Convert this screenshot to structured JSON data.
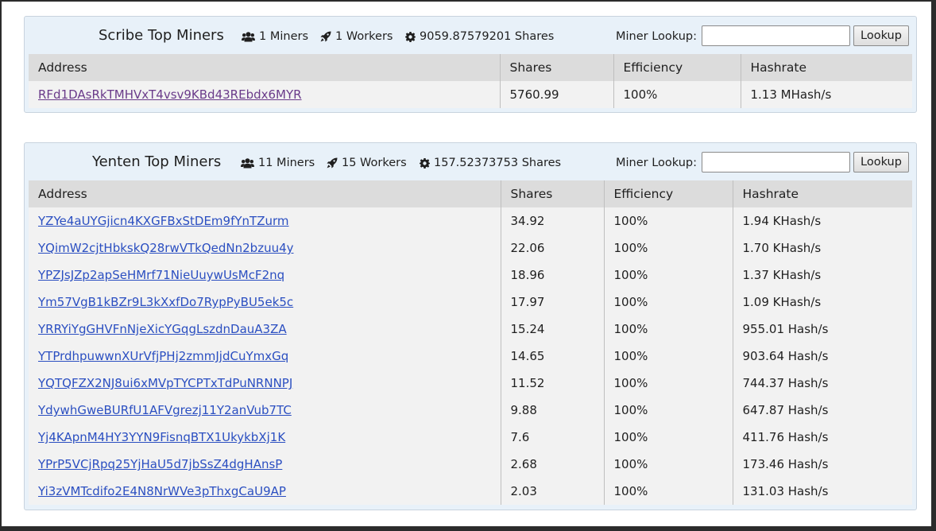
{
  "scribe": {
    "title": "Scribe Top Miners",
    "miners": "1 Miners",
    "workers": "1 Workers",
    "shares": "9059.87579201 Shares",
    "lookup_label": "Miner Lookup:",
    "lookup_value": "",
    "lookup_button": "Lookup",
    "columns": [
      "Address",
      "Shares",
      "Efficiency",
      "Hashrate"
    ],
    "rows": [
      {
        "address": "RFd1DAsRkTMHVxT4vsv9KBd43REbdx6MYR",
        "shares": "5760.99",
        "efficiency": "100%",
        "hashrate": "1.13 MHash/s"
      }
    ]
  },
  "yenten": {
    "title": "Yenten Top Miners",
    "miners": "11 Miners",
    "workers": "15 Workers",
    "shares": "157.52373753 Shares",
    "lookup_label": "Miner Lookup:",
    "lookup_value": "",
    "lookup_button": "Lookup",
    "columns": [
      "Address",
      "Shares",
      "Efficiency",
      "Hashrate"
    ],
    "rows": [
      {
        "address": "YZYe4aUYGjicn4KXGFBxStDEm9fYnTZurm",
        "shares": "34.92",
        "efficiency": "100%",
        "hashrate": "1.94 KHash/s"
      },
      {
        "address": "YQimW2cjtHbkskQ28rwVTkQedNn2bzuu4y",
        "shares": "22.06",
        "efficiency": "100%",
        "hashrate": "1.70 KHash/s"
      },
      {
        "address": "YPZJsJZp2apSeHMrf71NieUuywUsMcF2nq",
        "shares": "18.96",
        "efficiency": "100%",
        "hashrate": "1.37 KHash/s"
      },
      {
        "address": "Ym57VgB1kBZr9L3kXxfDo7RypPyBU5ek5c",
        "shares": "17.97",
        "efficiency": "100%",
        "hashrate": "1.09 KHash/s"
      },
      {
        "address": "YRRYiYgGHVFnNjeXicYGqgLszdnDauA3ZA",
        "shares": "15.24",
        "efficiency": "100%",
        "hashrate": "955.01 Hash/s"
      },
      {
        "address": "YTPrdhpuwwnXUrVfjPHj2zmmJjdCuYmxGq",
        "shares": "14.65",
        "efficiency": "100%",
        "hashrate": "903.64 Hash/s"
      },
      {
        "address": "YQTQFZX2NJ8ui6xMVpTYCPTxTdPuNRNNPJ",
        "shares": "11.52",
        "efficiency": "100%",
        "hashrate": "744.37 Hash/s"
      },
      {
        "address": "YdywhGweBURfU1AFVgrezj11Y2anVub7TC",
        "shares": "9.88",
        "efficiency": "100%",
        "hashrate": "647.87 Hash/s"
      },
      {
        "address": "Yj4KApnM4HY3YYN9FisnqBTX1UkykbXj1K",
        "shares": "7.6",
        "efficiency": "100%",
        "hashrate": "411.76 Hash/s"
      },
      {
        "address": "YPrP5VCjRpq25YjHaU5d7jbSsZ4dgHAnsP",
        "shares": "2.68",
        "efficiency": "100%",
        "hashrate": "173.46 Hash/s"
      },
      {
        "address": "Yi3zVMTcdifo2E4N8NrWVe3pThxgCaU9AP",
        "shares": "2.03",
        "efficiency": "100%",
        "hashrate": "131.03 Hash/s"
      }
    ]
  },
  "icons": {
    "miners": "users-icon",
    "workers": "rocket-icon",
    "shares": "gear-icon"
  },
  "colors": {
    "link": "#2b4fc1",
    "visited_link": "#6a3b8a",
    "panel_bg": "#e8f1f9",
    "header_bg": "#dcdcdc",
    "row_bg": "#f2f2f2"
  }
}
